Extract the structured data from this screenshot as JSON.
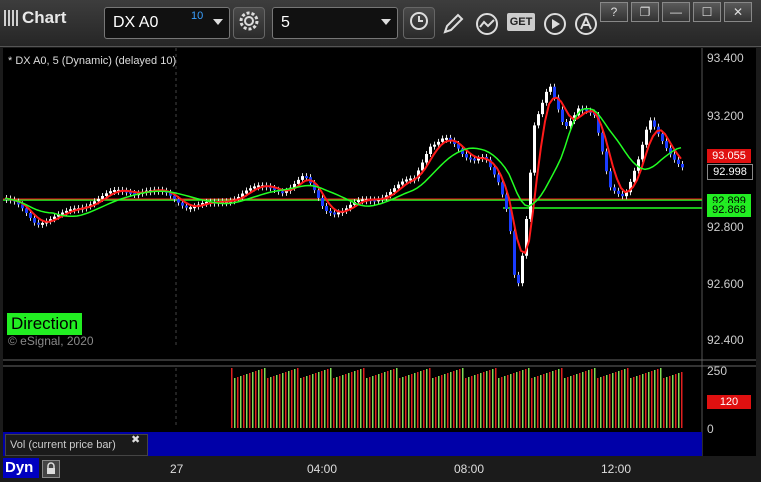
{
  "app": {
    "title": "Chart"
  },
  "toolbar": {
    "symbol": "DX A0",
    "symbol_delay": "10",
    "interval": "5",
    "get_label": "GET"
  },
  "window_buttons": [
    "?",
    "❐",
    "—",
    "☐",
    "✕"
  ],
  "chart": {
    "study_label": "* DX A0, 5 (Dynamic) (delayed 10)",
    "direction_label": "Direction",
    "copyright": "© eSignal, 2020",
    "volume_label": "Vol (current price bar)",
    "close_icon": "✖",
    "bottom_label": "Dyn",
    "price_axis": [
      "93.400",
      "93.200",
      "92.800",
      "92.600",
      "92.400"
    ],
    "price_tags": {
      "red": "93.055",
      "last": "92.998",
      "green1": "92.899",
      "green2": "92.868"
    },
    "volume_axis": [
      "250",
      "0"
    ],
    "volume_tag": "120",
    "time_axis": [
      "27",
      "04:00",
      "08:00",
      "12:00"
    ],
    "colors": {
      "up": "#ffffff",
      "down": "#1a3cff",
      "ma_red": "#ff1a1a",
      "ma_green": "#22ff22",
      "level_green": "#22ff22",
      "vol_up": "#7fdc55",
      "vol_down": "#e02020",
      "panel_blue": "#0000a8"
    }
  }
}
